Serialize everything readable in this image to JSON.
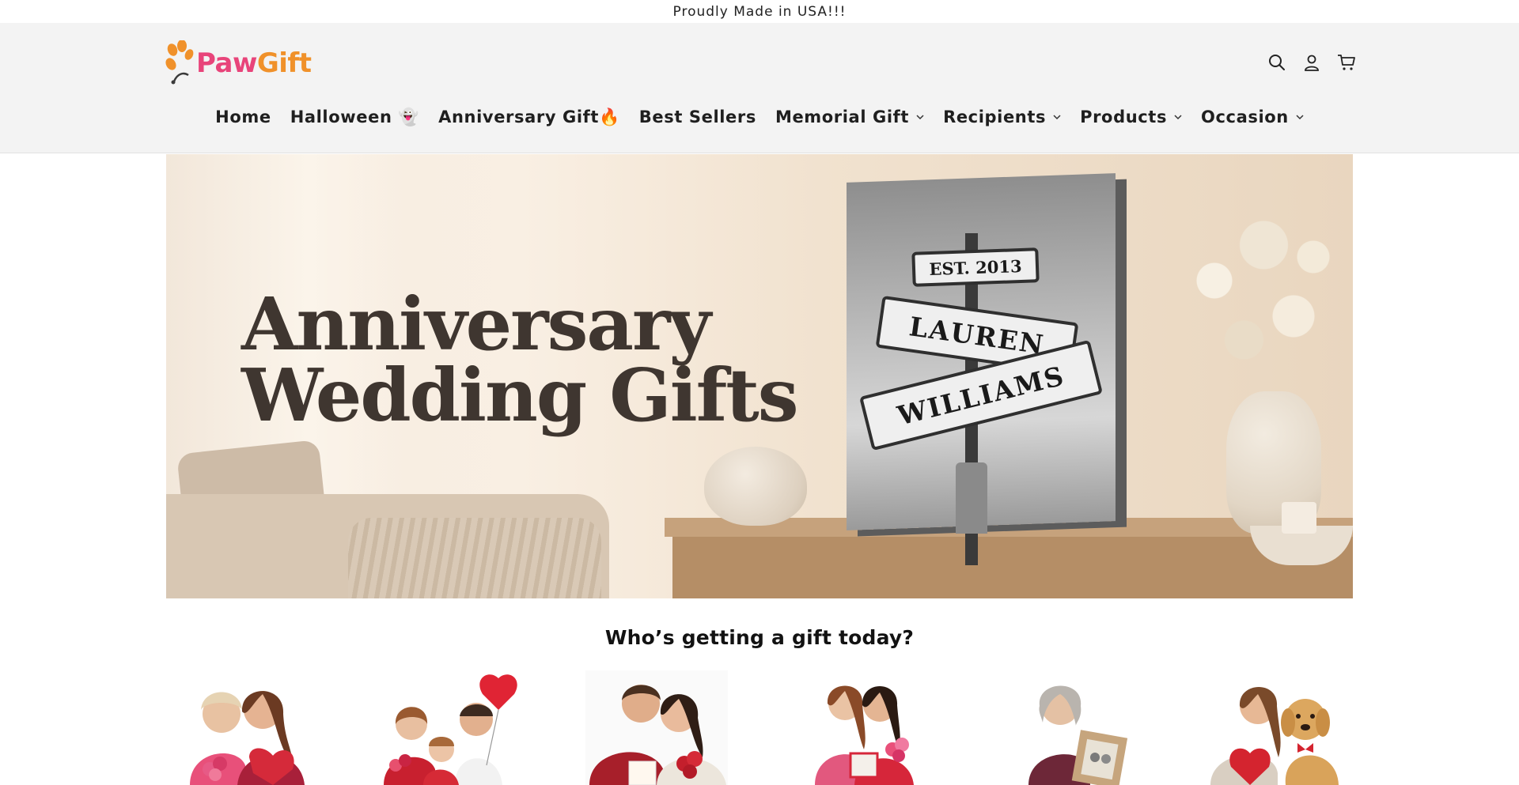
{
  "announcement": {
    "text": "Proudly Made in USA!!!"
  },
  "brand": {
    "paw": "Paw",
    "gift": "Gift",
    "paw_color": "#e8447a",
    "gift_color": "#f0912a"
  },
  "header_icons": [
    "search-icon",
    "account-icon",
    "cart-icon"
  ],
  "nav": {
    "items": [
      {
        "label": "Home",
        "has_dropdown": false
      },
      {
        "label": "Halloween 👻",
        "has_dropdown": false
      },
      {
        "label": "Anniversary Gift🔥",
        "has_dropdown": false
      },
      {
        "label": "Best Sellers",
        "has_dropdown": false
      },
      {
        "label": "Memorial Gift",
        "has_dropdown": true
      },
      {
        "label": "Recipients",
        "has_dropdown": true
      },
      {
        "label": "Products",
        "has_dropdown": true
      },
      {
        "label": "Occasion",
        "has_dropdown": true
      }
    ]
  },
  "hero": {
    "title_line1": "Anniversary",
    "title_line2": "Wedding Gifts",
    "sign_est": "EST. 2013",
    "sign_name1": "LAUREN",
    "sign_name2": "WILLIAMS"
  },
  "recipients_section": {
    "title": "Who’s getting a gift today?",
    "items": [
      {
        "name": "recipient-mom",
        "colors": {
          "body": "#e8507a",
          "hair": "#7a4a2a",
          "accent": "#d32f3f"
        }
      },
      {
        "name": "recipient-family",
        "colors": {
          "body": "#c8202f",
          "hair": "#6b3e22",
          "accent": "#e02434"
        }
      },
      {
        "name": "recipient-couple",
        "colors": {
          "body": "#a71f2a",
          "hair": "#3d2a20",
          "accent": "#e9e2d6"
        }
      },
      {
        "name": "recipient-friends",
        "colors": {
          "body": "#e2587e",
          "hair": "#3a2418",
          "accent": "#d6263a"
        }
      },
      {
        "name": "recipient-grandma",
        "colors": {
          "body": "#6d2738",
          "hair": "#b9b4ae",
          "accent": "#c6a57d"
        }
      },
      {
        "name": "recipient-pet-lover",
        "colors": {
          "body": "#d9cfc2",
          "hair": "#7a4a2a",
          "accent": "#d4242f"
        }
      }
    ]
  }
}
